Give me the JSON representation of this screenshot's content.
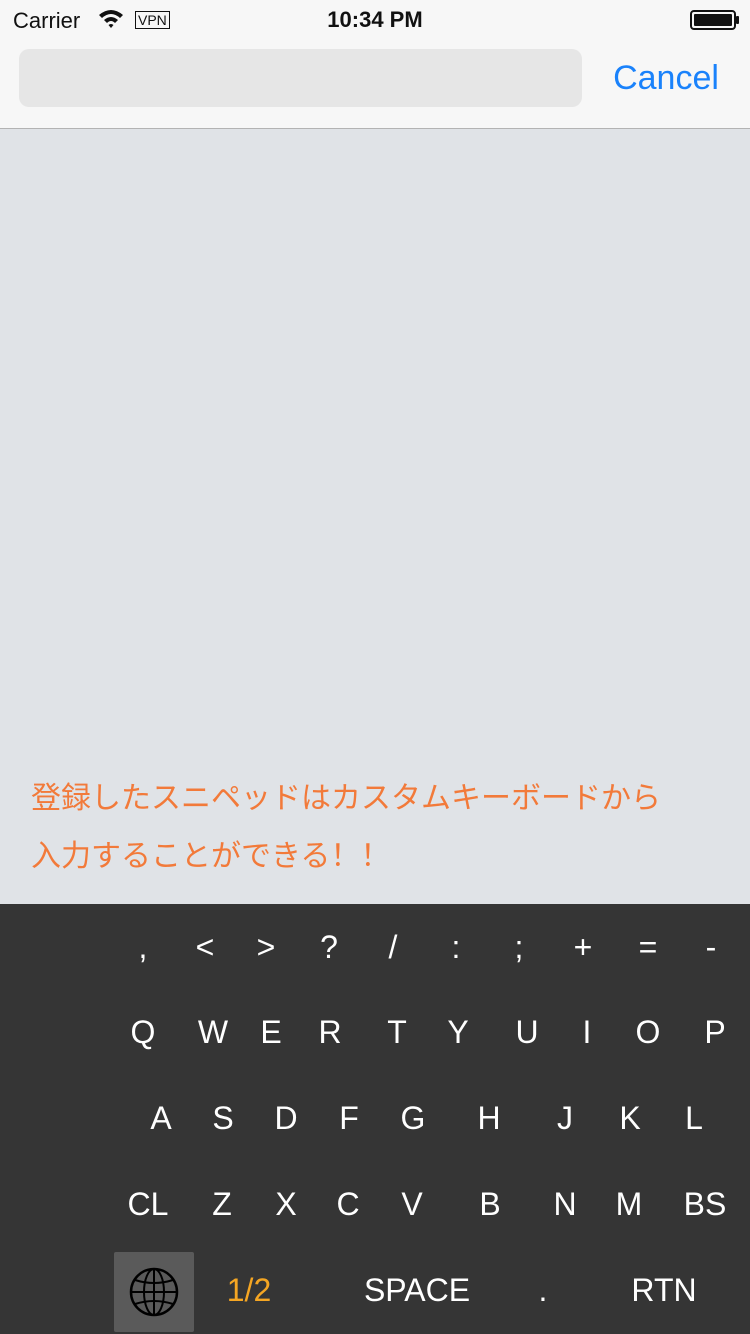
{
  "status_bar": {
    "carrier": "Carrier",
    "vpn": "VPN",
    "time": "10:34 PM"
  },
  "search": {
    "value": "",
    "placeholder": ""
  },
  "cancel_label": "Cancel",
  "message": {
    "line1": "登録したスニペッドはカスタムキーボードから",
    "line2": "入力することができる！！"
  },
  "keyboard": {
    "row1": [
      ",",
      "<",
      ">",
      "?",
      "/",
      ":",
      ";",
      "+",
      "=",
      "-"
    ],
    "row2": [
      "Q",
      "W",
      "E",
      "R",
      "T",
      "Y",
      "U",
      "I",
      "O",
      "P"
    ],
    "row3": [
      "A",
      "S",
      "D",
      "F",
      "G",
      "H",
      "J",
      "K",
      "L"
    ],
    "row4": [
      "CL",
      "Z",
      "X",
      "C",
      "V",
      "B",
      "N",
      "M",
      "BS"
    ],
    "page": "1/2",
    "space": "SPACE",
    "period": ".",
    "return": "RTN",
    "globe_icon": "globe-icon"
  },
  "colors": {
    "accent_blue": "#1a82fb",
    "message_orange": "#f27a3a",
    "keyboard_bg": "#353535",
    "page_indicator": "#f5a623"
  }
}
